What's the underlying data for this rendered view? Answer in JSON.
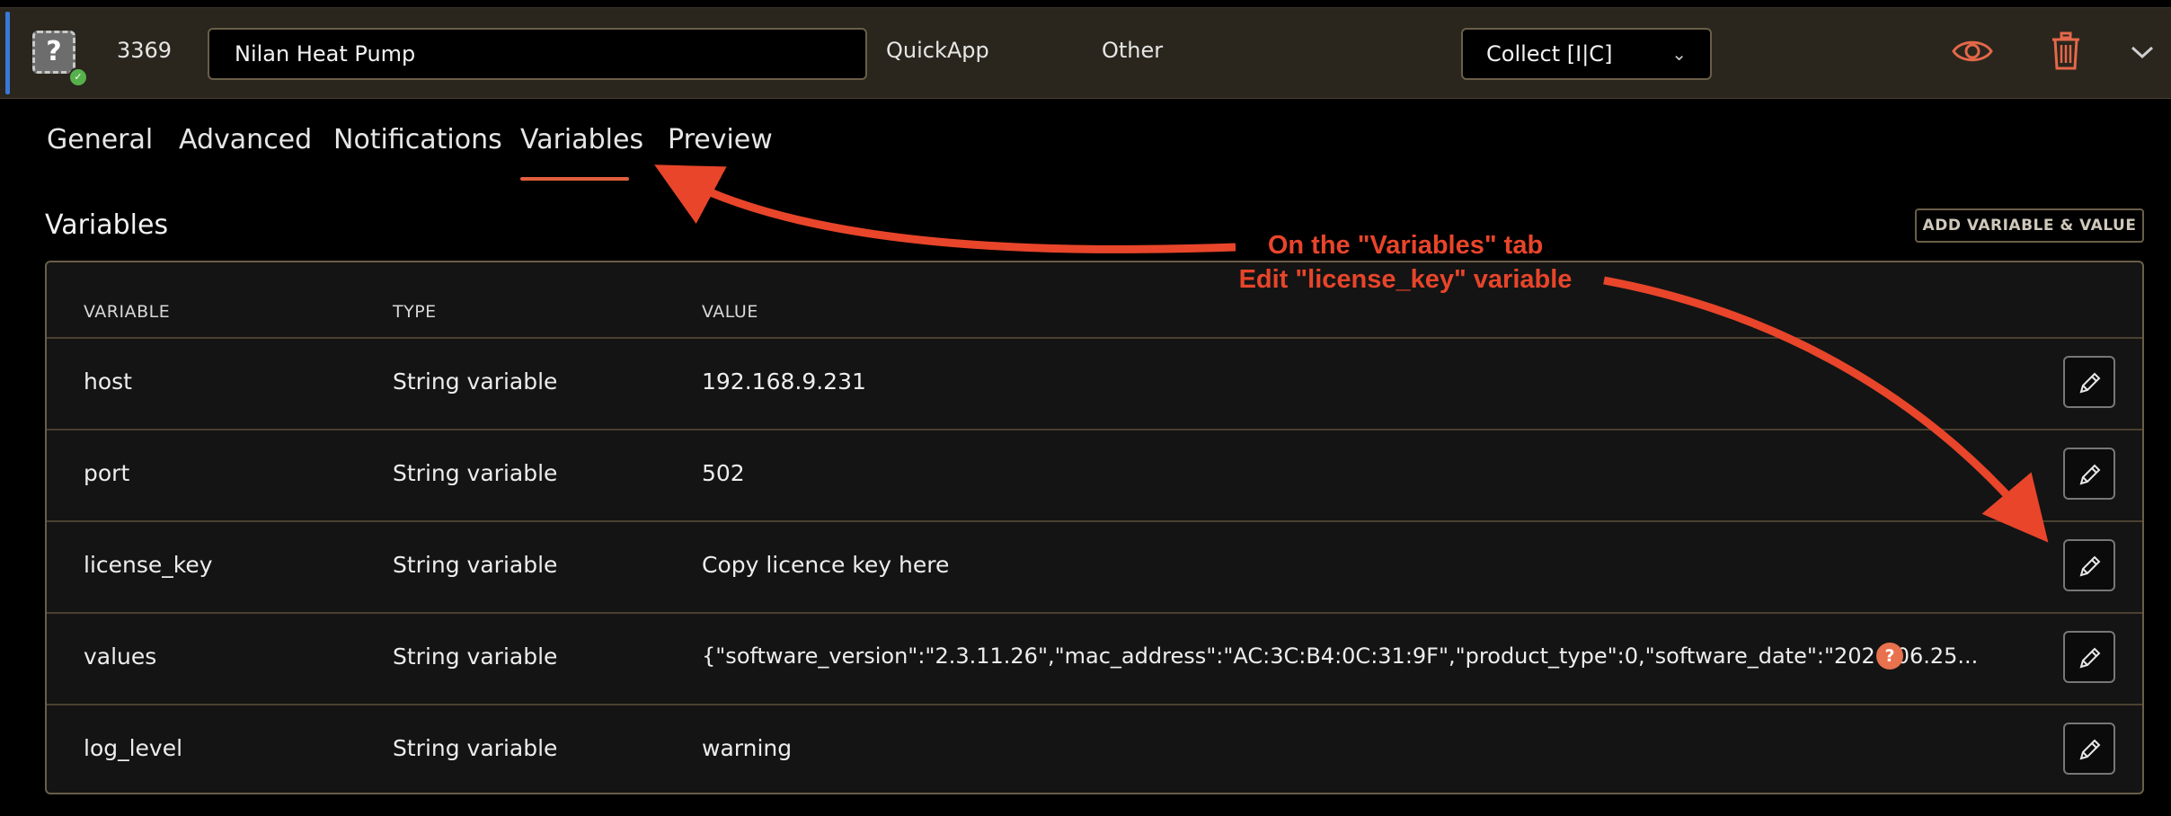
{
  "header": {
    "device_icon_glyph": "?",
    "device_id": "3369",
    "device_name": "Nilan Heat Pump",
    "type": "QuickApp",
    "category": "Other",
    "collect_value": "Collect [I|C]",
    "icons": [
      "question-device-icon",
      "check-badge-icon",
      "eye-icon",
      "trash-icon",
      "chevron-down-icon"
    ],
    "accent_color": "#3a78d8"
  },
  "tabs": [
    {
      "label": "General",
      "active": false
    },
    {
      "label": "Advanced",
      "active": false
    },
    {
      "label": "Notifications",
      "active": false
    },
    {
      "label": "Variables",
      "active": true
    },
    {
      "label": "Preview",
      "active": false
    }
  ],
  "variables": {
    "title": "Variables",
    "add_button": "ADD VARIABLE & VALUE",
    "columns": {
      "variable": "VARIABLE",
      "type": "TYPE",
      "value": "VALUE"
    },
    "rows": [
      {
        "name": "host",
        "type": "String variable",
        "value": "192.168.9.231"
      },
      {
        "name": "port",
        "type": "String variable",
        "value": "502"
      },
      {
        "name": "license_key",
        "type": "String variable",
        "value": "Copy licence key here"
      },
      {
        "name": "values",
        "type": "String variable",
        "value": "{\"software_version\":\"2.3.11.26\",\"mac_address\":\"AC:3C:B4:0C:31:9F\",\"product_type\":0,\"software_date\":\"2020.06.25...",
        "help": "?"
      },
      {
        "name": "log_level",
        "type": "String variable",
        "value": "warning"
      }
    ]
  },
  "annotation": {
    "line1": "On the \"Variables\" tab",
    "line2": "Edit \"license_key\" variable",
    "color": "#e8452a"
  },
  "colors": {
    "accent": "#e05f3c",
    "border": "#6a5e48",
    "header_bg": "#2a261d"
  }
}
